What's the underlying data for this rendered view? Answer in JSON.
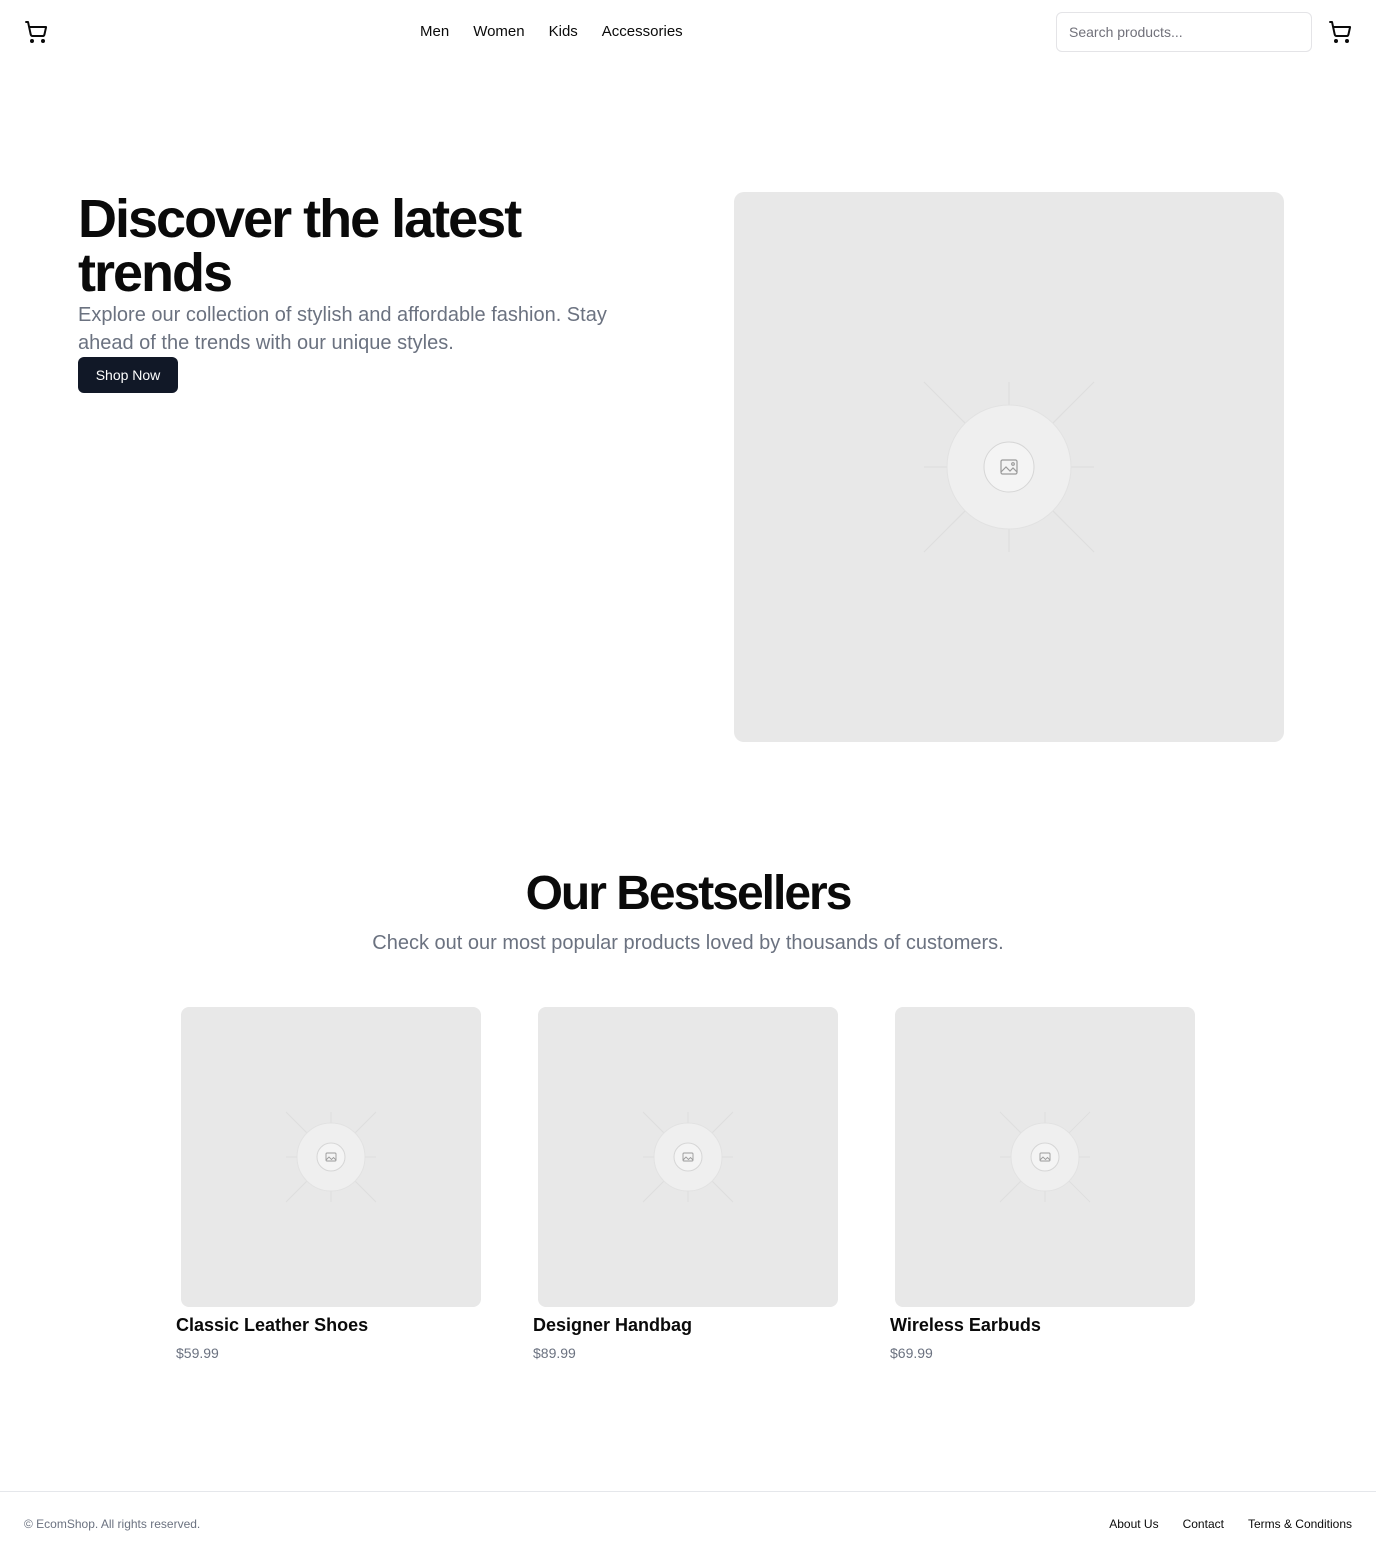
{
  "header": {
    "nav": [
      "Men",
      "Women",
      "Kids",
      "Accessories"
    ],
    "search_placeholder": "Search products...",
    "logo_icon": "shopping-cart-icon",
    "cart_icon": "shopping-cart-icon"
  },
  "hero": {
    "title": "Discover the latest trends",
    "subtitle": "Explore our collection of stylish and affordable fashion. Stay ahead of the trends with our unique styles.",
    "cta": "Shop Now",
    "image_icon": "image-placeholder-icon"
  },
  "bestsellers": {
    "title": "Our Bestsellers",
    "subtitle": "Check out our most popular products loved by thousands of customers.",
    "products": [
      {
        "name": "Classic Leather Shoes",
        "price": "$59.99"
      },
      {
        "name": "Designer Handbag",
        "price": "$89.99"
      },
      {
        "name": "Wireless Earbuds",
        "price": "$69.99"
      }
    ]
  },
  "footer": {
    "copyright": "© EcomShop. All rights reserved.",
    "links": [
      "About Us",
      "Contact",
      "Terms & Conditions"
    ]
  },
  "colors": {
    "primary_button": "#111827",
    "muted_text": "#6b7280",
    "placeholder_bg": "#e8e8e8"
  }
}
